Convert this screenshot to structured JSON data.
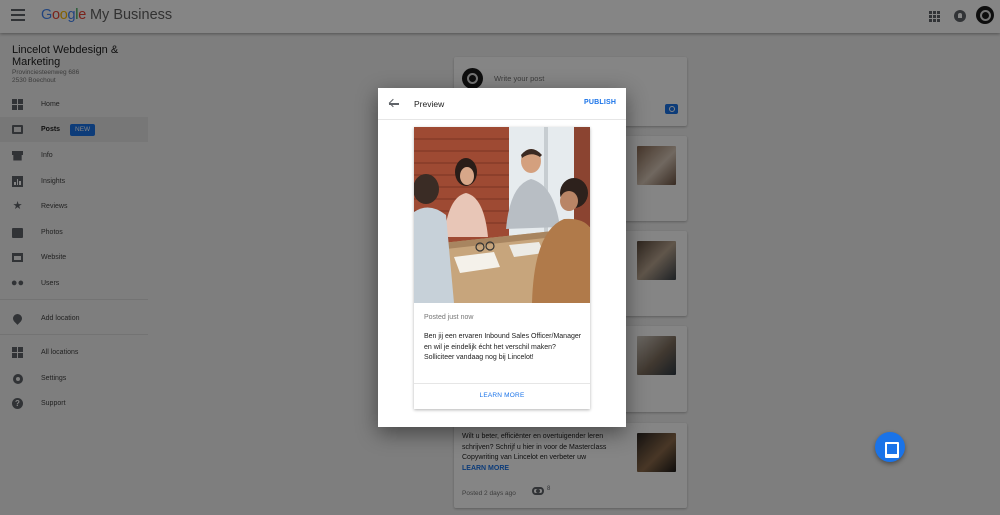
{
  "topbar": {
    "logo_google_letters": [
      "G",
      "o",
      "o",
      "g",
      "l",
      "e"
    ],
    "logo_product": "My Business",
    "icons": [
      "menu-icon",
      "apps-icon",
      "notifications-icon",
      "account-avatar"
    ]
  },
  "sidebar": {
    "business_name": "Lincelot Webdesign & Marketing",
    "address_line1": "Provinciesteenweg 686",
    "address_line2": "2530 Boechout",
    "items": [
      {
        "label": "Home",
        "icon": "dashboard-icon"
      },
      {
        "label": "Posts",
        "icon": "posts-icon",
        "badge": "NEW"
      },
      {
        "label": "Info",
        "icon": "storefront-icon"
      },
      {
        "label": "Insights",
        "icon": "insights-icon"
      },
      {
        "label": "Reviews",
        "icon": "star-icon"
      },
      {
        "label": "Photos",
        "icon": "photos-icon"
      },
      {
        "label": "Website",
        "icon": "website-icon"
      },
      {
        "label": "Users",
        "icon": "users-icon"
      },
      {
        "label": "Add location",
        "icon": "location-pin-icon"
      },
      {
        "label": "All locations",
        "icon": "buildings-icon"
      },
      {
        "label": "Settings",
        "icon": "gear-icon"
      },
      {
        "label": "Support",
        "icon": "help-icon"
      }
    ]
  },
  "compose": {
    "placeholder": "Write your post"
  },
  "posts": [
    {
      "text": "Wilt u beter, efficiënter en overtuigender leren schrijven? Schrijf u hier in voor de Masterclass Copywriting van Lincelot en verbeter uw",
      "link": "LEARN MORE",
      "meta": "Posted 2 days ago",
      "views": "8"
    }
  ],
  "dialog": {
    "title": "Preview",
    "publish_label": "PUBLISH",
    "posted_label": "Posted just now",
    "body": "Ben jij een ervaren Inbound Sales Officer/Manager en wil je eindelijk écht het verschil maken? Solliciteer vandaag nog bij Lincelot!",
    "cta_label": "LEARN MORE"
  },
  "colors": {
    "accent": "#1a73e8",
    "scrim": "rgba(0,0,0,0.48)"
  }
}
